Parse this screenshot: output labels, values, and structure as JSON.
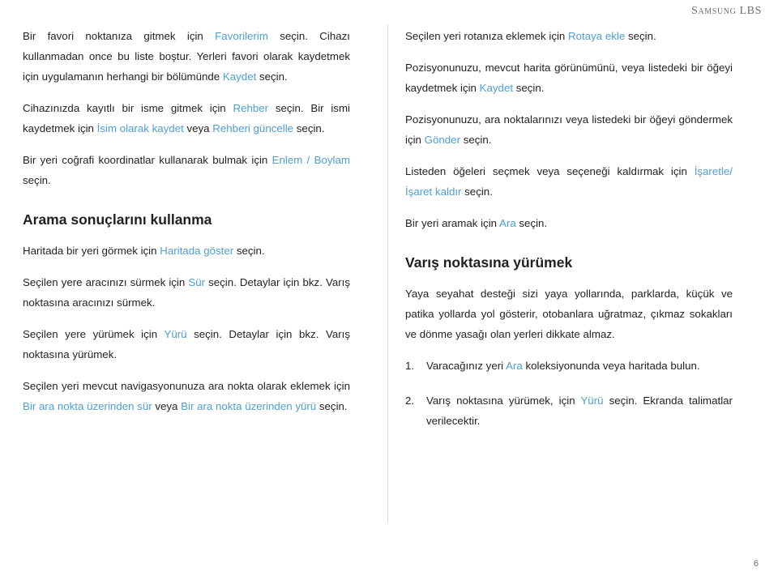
{
  "header": {
    "brand": "Samsung LBS"
  },
  "left_column": {
    "paragraphs": [
      [
        {
          "t": "Bir favori noktanıza gitmek için ",
          "link": false
        },
        {
          "t": "Favorilerim",
          "link": true
        },
        {
          "t": " seçin. Cihazı kullanmadan once bu liste boştur. ",
          "link": false
        },
        {
          "t": "Yerleri favori olarak kaydetmek için uygulamanın herhangi bir bölümünde ",
          "link": false
        },
        {
          "t": "Kaydet",
          "link": true
        },
        {
          "t": " seçin.",
          "link": false
        }
      ],
      [
        {
          "t": "Cihazınızda kayıtlı bir isme gitmek için ",
          "link": false
        },
        {
          "t": "Rehber",
          "link": true
        },
        {
          "t": " seçin. Bir ismi kaydetmek için ",
          "link": false
        },
        {
          "t": "İsim olarak kaydet",
          "link": true
        },
        {
          "t": " veya ",
          "link": false
        },
        {
          "t": "Rehberi güncelle",
          "link": true
        },
        {
          "t": " seçin.",
          "link": false
        }
      ],
      [
        {
          "t": "Bir yeri coğrafi koordinatlar kullanarak bulmak için ",
          "link": false
        },
        {
          "t": "Enlem / Boylam",
          "link": true
        },
        {
          "t": " seçin.",
          "link": false
        }
      ]
    ],
    "heading": "Arama sonuçlarını kullanma",
    "paragraphs2": [
      [
        {
          "t": "Haritada bir yeri görmek için ",
          "link": false
        },
        {
          "t": "Haritada göster",
          "link": true
        },
        {
          "t": " seçin.",
          "link": false
        }
      ],
      [
        {
          "t": "Seçilen yere aracınızı sürmek için ",
          "link": false
        },
        {
          "t": "Sür",
          "link": true
        },
        {
          "t": " seçin. Detaylar için bkz. Varış noktasına aracınızı sürmek.",
          "link": false
        }
      ],
      [
        {
          "t": "Seçilen yere yürümek için ",
          "link": false
        },
        {
          "t": "Yürü",
          "link": true
        },
        {
          "t": " seçin. Detaylar için bkz. Varış noktasına yürümek.",
          "link": false
        }
      ],
      [
        {
          "t": "Seçilen yeri mevcut navigasyonunuza ara nokta olarak eklemek için ",
          "link": false
        },
        {
          "t": "Bir ara nokta üzerinden sür",
          "link": true
        },
        {
          "t": " veya ",
          "link": false
        },
        {
          "t": "Bir ara nokta üzerinden yürü",
          "link": true
        },
        {
          "t": " seçin.",
          "link": false
        }
      ]
    ]
  },
  "right_column": {
    "paragraphs": [
      [
        {
          "t": "Seçilen yeri rotanıza eklemek için ",
          "link": false
        },
        {
          "t": "Rotaya ekle",
          "link": true
        },
        {
          "t": " seçin.",
          "link": false
        }
      ],
      [
        {
          "t": "Pozisyonunuzu, mevcut harita görünümünü, veya listedeki bir öğeyi kaydetmek için ",
          "link": false
        },
        {
          "t": "Kaydet",
          "link": true
        },
        {
          "t": " seçin.",
          "link": false
        }
      ],
      [
        {
          "t": "Pozisyonunuzu, ara noktalarınızı veya listedeki bir öğeyi göndermek için ",
          "link": false
        },
        {
          "t": "Gönder",
          "link": true
        },
        {
          "t": " seçin.",
          "link": false
        }
      ],
      [
        {
          "t": "Listeden öğeleri seçmek veya seçeneği kaldırmak için ",
          "link": false
        },
        {
          "t": "İşaretle/ İşaret kaldır",
          "link": true
        },
        {
          "t": " seçin.",
          "link": false
        }
      ],
      [
        {
          "t": "Bir yeri aramak için ",
          "link": false
        },
        {
          "t": "Ara",
          "link": true
        },
        {
          "t": " seçin.",
          "link": false
        }
      ]
    ],
    "heading": "Varış noktasına yürümek",
    "intro": [
      {
        "t": "Yaya seyahat desteği sizi yaya yollarında, parklarda, küçük ve patika yollarda yol gösterir, otobanlara uğratmaz, çıkmaz sokakları ve dönme yasağı olan yerleri dikkate almaz.",
        "link": false
      }
    ],
    "steps": [
      {
        "num": "1.",
        "parts": [
          {
            "t": "Varacağınız yeri ",
            "link": false
          },
          {
            "t": "Ara",
            "link": true
          },
          {
            "t": " koleksiyonunda veya haritada bulun.",
            "link": false
          }
        ]
      },
      {
        "num": "2.",
        "parts": [
          {
            "t": "Varış noktasına yürümek, için ",
            "link": false
          },
          {
            "t": "Yürü",
            "link": true
          },
          {
            "t": " seçin. Ekranda talimatlar verilecektir.",
            "link": false
          }
        ]
      }
    ]
  },
  "footer": {
    "page_number": "6"
  },
  "colors": {
    "link": "#4e9fd4",
    "text": "#231f20",
    "muted": "#6d6e71"
  }
}
